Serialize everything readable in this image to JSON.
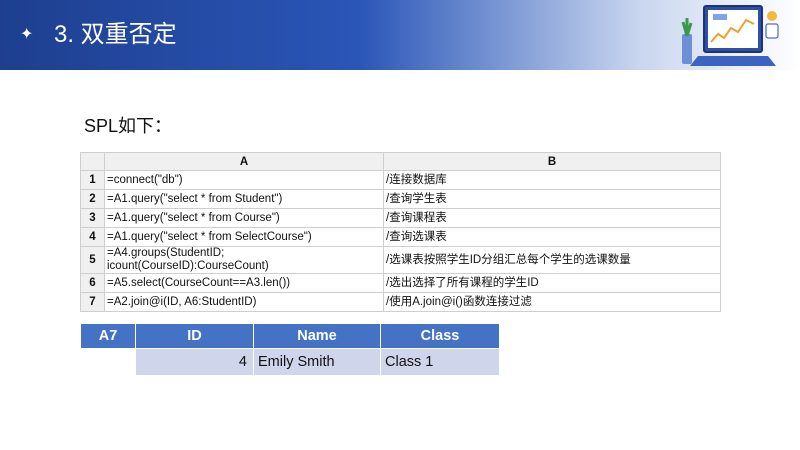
{
  "header": {
    "title": "3. 双重否定"
  },
  "intro": "SPL如下：",
  "grid": {
    "columns": [
      "A",
      "B"
    ],
    "rows": [
      {
        "n": "1",
        "a": "=connect(\"db\")",
        "b": "/连接数据库"
      },
      {
        "n": "2",
        "a": "=A1.query(\"select * from Student\")",
        "b": "/查询学生表"
      },
      {
        "n": "3",
        "a": "=A1.query(\"select * from Course\")",
        "b": "/查询课程表"
      },
      {
        "n": "4",
        "a": "=A1.query(\"select * from SelectCourse\")",
        "b": "/查询选课表"
      },
      {
        "n": "5",
        "a1": "=A4.groups(StudentID;",
        "a2": "icount(CourseID):CourseCount)",
        "b": "/选课表按照学生ID分组汇总每个学生的选课数量"
      },
      {
        "n": "6",
        "a": "=A5.select(CourseCount==A3.len())",
        "b": "/选出选择了所有课程的学生ID"
      },
      {
        "n": "7",
        "a": "=A2.join@i(ID, A6:StudentID)",
        "b": "/使用A.join@i()函数连接过滤"
      }
    ]
  },
  "result": {
    "headers": [
      "A7",
      "ID",
      "Name",
      "Class"
    ],
    "row": {
      "id": "4",
      "name": "Emily Smith",
      "class": "Class 1"
    }
  }
}
